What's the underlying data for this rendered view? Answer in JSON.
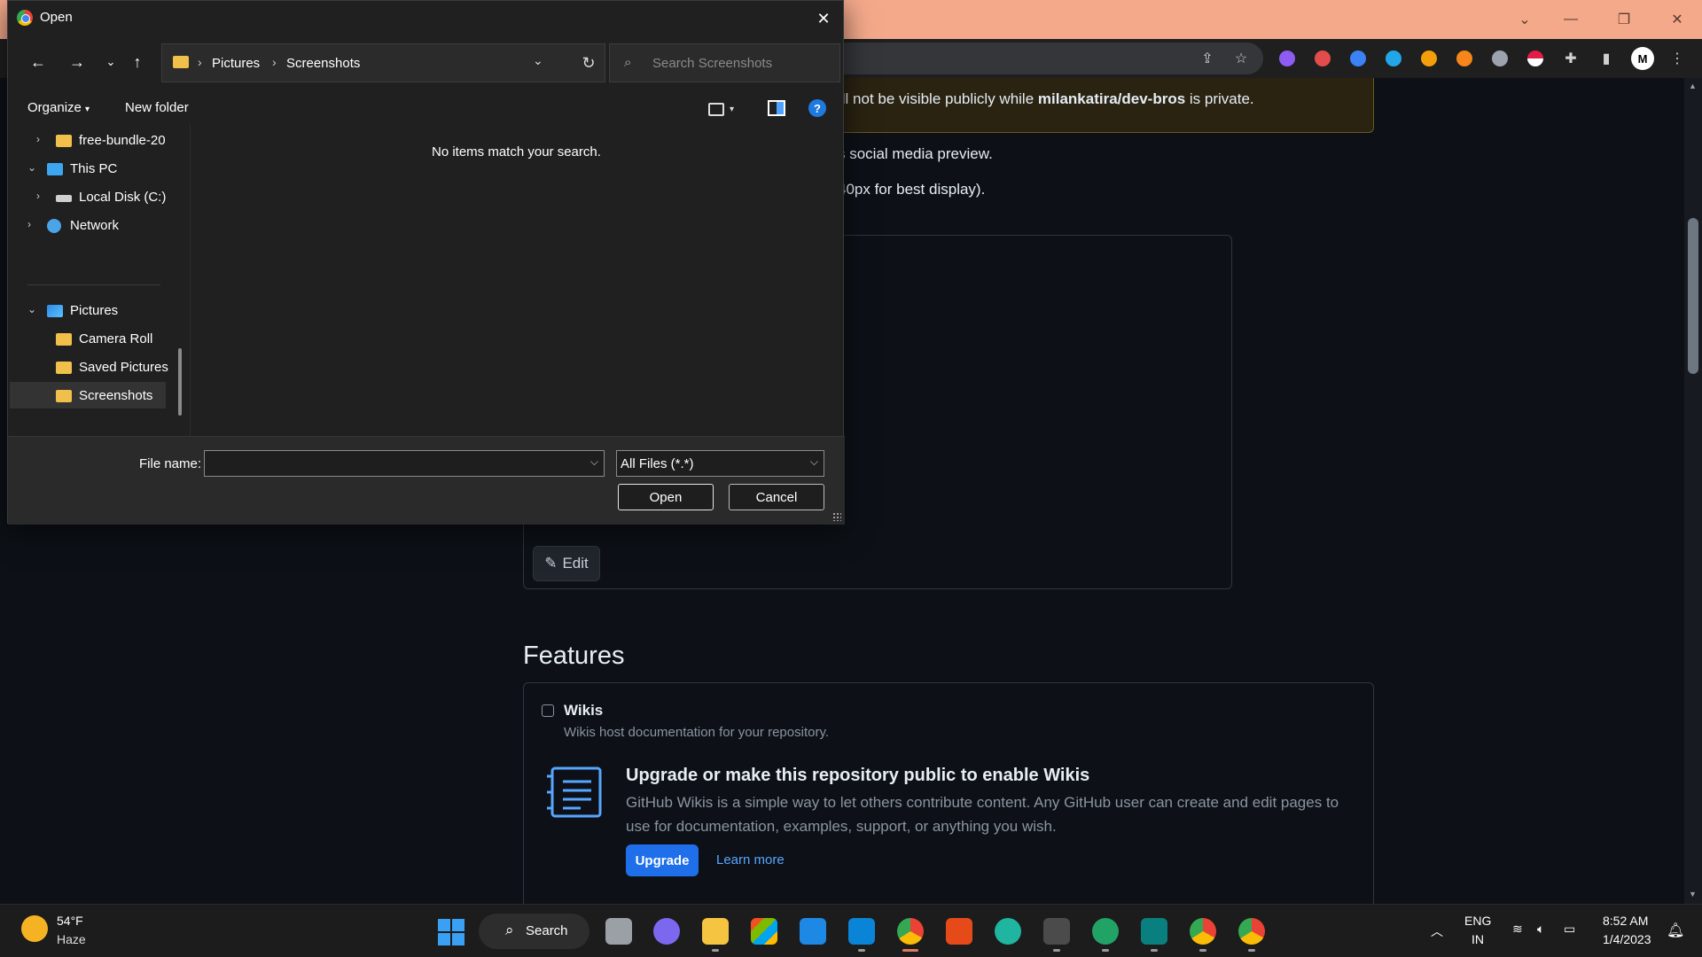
{
  "dialog": {
    "title": "Open",
    "breadcrumbs": [
      "Pictures",
      "Screenshots"
    ],
    "search_placeholder": "Search Screenshots",
    "command_bar": {
      "organize": "Organize",
      "new_folder": "New folder",
      "help": "?"
    },
    "nav_items": [
      {
        "label": "free-bundle-20",
        "icon": "folder-icon"
      },
      {
        "label": "This PC",
        "icon": "computer-icon"
      },
      {
        "label": "Local Disk (C:)",
        "icon": "disk-icon"
      },
      {
        "label": "Network",
        "icon": "network-icon"
      },
      {
        "label": "Pictures",
        "icon": "pictures-icon"
      },
      {
        "label": "Camera Roll",
        "icon": "folder-icon"
      },
      {
        "label": "Saved Pictures",
        "icon": "folder-icon"
      },
      {
        "label": "Screenshots",
        "icon": "folder-icon",
        "selected": true
      }
    ],
    "empty_message": "No items match your search.",
    "file_name_label": "File name:",
    "file_name_value": "",
    "file_type_selected": "All Files (*.*)",
    "open_label": "Open",
    "cancel_label": "Cancel"
  },
  "page": {
    "banner_prefix": "ill not be visible publicly while ",
    "banner_repo": "milankatira/dev-bros",
    "banner_suffix": " is private.",
    "line1": "s social media preview.",
    "line2": "40px for best display).",
    "edit_label": "Edit",
    "features_title": "Features",
    "wikis_label": "Wikis",
    "wikis_desc": "Wikis host documentation for your repository.",
    "upgrade_title": "Upgrade or make this repository public to enable Wikis",
    "upgrade_desc": "GitHub Wikis is a simple way to let others contribute content. Any GitHub user can create and edit pages to use for documentation, examples, support, or anything you wish.",
    "upgrade_button": "Upgrade",
    "learn_more": "Learn more"
  },
  "chrome": {
    "profile_initial": "M"
  },
  "taskbar": {
    "weather_temp": "54°F",
    "weather_cond": "Haze",
    "search_label": "Search",
    "lang_1": "ENG",
    "lang_2": "IN",
    "time": "8:52 AM",
    "date": "1/4/2023"
  },
  "colors": {
    "accent": "#1f6feb",
    "link": "#58a6ff",
    "titlebar": "#f4a98b"
  }
}
